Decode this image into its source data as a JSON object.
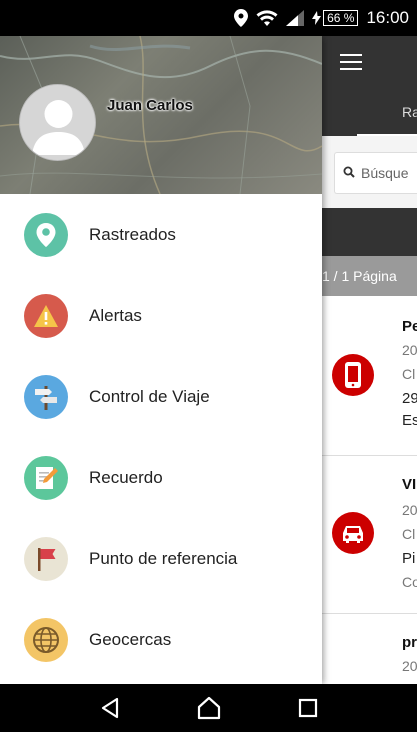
{
  "status_bar": {
    "battery": "66 %",
    "time": "16:00"
  },
  "drawer": {
    "user_name": "Juan Carlos",
    "items": [
      {
        "label": "Rastreados",
        "icon": "location-pin-icon",
        "color": "#5dc2a6"
      },
      {
        "label": "Alertas",
        "icon": "warning-icon",
        "color": "#d65a4c"
      },
      {
        "label": "Control de Viaje",
        "icon": "signpost-icon",
        "color": "#5aa8e0"
      },
      {
        "label": "Recuerdo",
        "icon": "notepad-pencil-icon",
        "color": "#5cc79b"
      },
      {
        "label": "Punto de referencia",
        "icon": "flag-icon",
        "color": "#e9e4d4"
      },
      {
        "label": "Geocercas",
        "icon": "globe-icon",
        "color": "#f3c566"
      }
    ]
  },
  "background_app": {
    "tab_label": "Ra",
    "search_placeholder": "Búsque",
    "pager": "1 / 1 Página",
    "items": [
      {
        "title": "Pe",
        "line1": "20",
        "line2": "Cl",
        "line3": "29",
        "line4": "Es",
        "icon": "phone-icon"
      },
      {
        "title": "VI",
        "line1": "20",
        "line2": "Cl",
        "line3": "Pi",
        "line4": "Co",
        "icon": "car-icon"
      },
      {
        "title": "pr",
        "line1": "20"
      }
    ]
  }
}
